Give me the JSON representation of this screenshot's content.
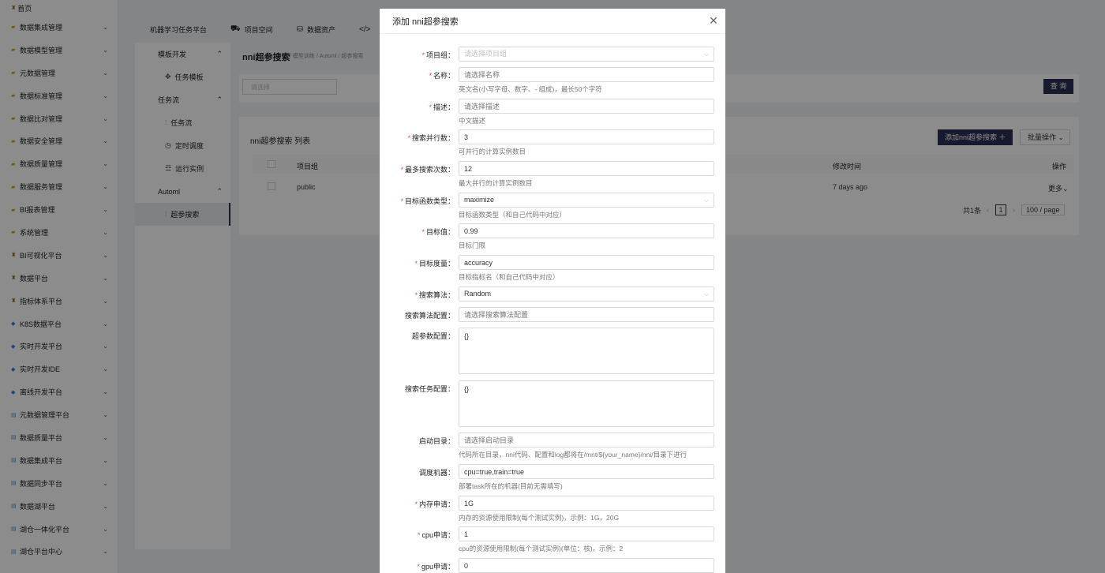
{
  "sidebar": {
    "home": "首页",
    "items": [
      {
        "label": "数据集成管理",
        "icon": "folder-icon"
      },
      {
        "label": "数据模型管理",
        "icon": "folder-icon"
      },
      {
        "label": "元数据管理",
        "icon": "folder-icon"
      },
      {
        "label": "数据标准管理",
        "icon": "folder-icon"
      },
      {
        "label": "数据比对管理",
        "icon": "folder-icon"
      },
      {
        "label": "数据安全管理",
        "icon": "folder-icon"
      },
      {
        "label": "数据质量管理",
        "icon": "folder-icon"
      },
      {
        "label": "数据服务管理",
        "icon": "folder-icon"
      },
      {
        "label": "BI报表管理",
        "icon": "folder-icon"
      },
      {
        "label": "系统管理",
        "icon": "folder-icon"
      },
      {
        "label": "BI可视化平台",
        "icon": "person-icon"
      },
      {
        "label": "数据平台",
        "icon": "person-icon"
      },
      {
        "label": "指标体系平台",
        "icon": "person-icon"
      },
      {
        "label": "K8S数据平台",
        "icon": "diamond-icon"
      },
      {
        "label": "实时开发平台",
        "icon": "diamond-icon"
      },
      {
        "label": "实时开发IDE",
        "icon": "diamond-icon"
      },
      {
        "label": "离线开发平台",
        "icon": "diamond-icon"
      },
      {
        "label": "元数据管理平台",
        "icon": "chart-icon"
      },
      {
        "label": "数据质量平台",
        "icon": "chart-icon"
      },
      {
        "label": "数据集成平台",
        "icon": "chart-icon"
      },
      {
        "label": "数据同步平台",
        "icon": "chart-icon"
      },
      {
        "label": "数据湖平台",
        "icon": "chart-icon"
      },
      {
        "label": "湖仓一体化平台",
        "icon": "chart-icon"
      },
      {
        "label": "湖仓平台中心",
        "icon": "chart-icon"
      }
    ]
  },
  "topnav": {
    "platform": "机器学习任务平台",
    "project_space": "项目空间",
    "data_assets": "数据资产"
  },
  "submenu": {
    "group1": "模板开发",
    "task_template": "任务模板",
    "group2": "任务流",
    "task_flow": "任务流",
    "scheduled": "定时调度",
    "run_instance": "运行实例",
    "group3": "Automl",
    "hyper_search": "超参搜索"
  },
  "main": {
    "title": "nni超参搜索",
    "breadcrumb": "/ 模型训练 / Automl / 超参搜索",
    "filter_placeholder": "请选择",
    "query_button": "查 询",
    "list_title": "nni超参搜索 列表",
    "add_button": "添加nni超参搜索 ＋",
    "batch_button": "批量操作 ⌄",
    "columns": {
      "project": "项目组",
      "modified": "修改时间",
      "action": "操作"
    },
    "row": {
      "project": "public",
      "modified": "7 days ago",
      "action": "更多⌄"
    },
    "pager": {
      "total": "共1条",
      "page": "1",
      "page_size": "100 / page"
    }
  },
  "modal": {
    "title": "添加 nni超参搜索",
    "fields": {
      "project": {
        "label": "项目组：",
        "placeholder": "请选择项目组"
      },
      "name": {
        "label": "名称：",
        "placeholder": "请选择名称",
        "help": "英文名(小写字母、数字、- 组成)，最长50个字符"
      },
      "desc": {
        "label": "描述：",
        "placeholder": "请选择描述",
        "help": "中文描述"
      },
      "parallel": {
        "label": "搜索并行数：",
        "value": "3",
        "help": "可并行的计算实例数目"
      },
      "max_trials": {
        "label": "最多搜索次数：",
        "value": "12",
        "help": "最大并行的计算实例数目"
      },
      "objective_type": {
        "label": "目标函数类型：",
        "value": "maximize",
        "help": "目标函数类型（和自己代码中对应）"
      },
      "goal": {
        "label": "目标值：",
        "value": "0.99",
        "help": "目标门限"
      },
      "metric": {
        "label": "目标度量：",
        "value": "accuracy",
        "help": "目标指标名（和自己代码中对应）"
      },
      "algorithm": {
        "label": "搜索算法：",
        "value": "Random"
      },
      "algo_config": {
        "label": "搜索算法配置：",
        "placeholder": "请选择搜索算法配置"
      },
      "hyper_config": {
        "label": "超参数配置：",
        "value": "{}"
      },
      "task_config": {
        "label": "搜索任务配置：",
        "value": "{}"
      },
      "workdir": {
        "label": "启动目录：",
        "placeholder": "请选择启动目录",
        "help": "代码所在目录，nni代码、配置和log都将在/mnt/${your_name}/nni/目录下进行"
      },
      "node": {
        "label": "调度机器：",
        "value": "cpu=true,train=true",
        "help": "部署task所在的机器(目前无需填写)"
      },
      "memory": {
        "label": "内存申请：",
        "value": "1G",
        "help": "内存的资源使用限制(每个测试实例)，示例：1G，20G"
      },
      "cpu": {
        "label": "cpu申请：",
        "value": "1",
        "help": "cpu的资源使用限制(每个测试实例)(单位：核)，示例：2"
      },
      "gpu": {
        "label": "gpu申请：",
        "value": "0"
      }
    }
  }
}
